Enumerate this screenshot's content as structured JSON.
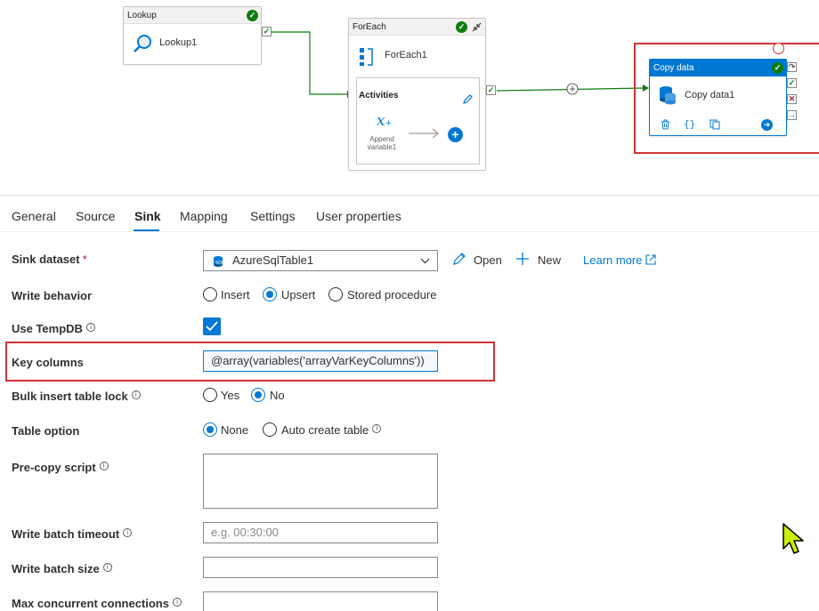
{
  "canvas": {
    "lookup": {
      "header": "Lookup",
      "name": "Lookup1",
      "icon": "search-icon"
    },
    "foreach": {
      "header": "ForEach",
      "name": "ForEach1",
      "activities_label": "Activities",
      "inner_activity": [
        "Append",
        "variable1"
      ],
      "inner_icon": "append-variable-icon"
    },
    "copy": {
      "header": "Copy data",
      "name": "Copy data1",
      "icon": "database-icon",
      "actions": [
        "delete-icon",
        "code-icon",
        "copy-icon",
        "arrow-right-icon"
      ]
    }
  },
  "tabs": [
    "General",
    "Source",
    "Sink",
    "Mapping",
    "Settings",
    "User properties"
  ],
  "active_tab": "Sink",
  "form": {
    "sink_dataset": {
      "label": "Sink dataset",
      "required_mark": "*",
      "value": "AzureSqlTable1",
      "open_label": "Open",
      "new_label": "New",
      "learn_more": "Learn more"
    },
    "write_behavior": {
      "label": "Write behavior",
      "options": [
        "Insert",
        "Upsert",
        "Stored procedure"
      ],
      "selected": "Upsert"
    },
    "use_tempdb": {
      "label": "Use TempDB",
      "checked": true
    },
    "key_columns": {
      "label": "Key columns",
      "value": "@array(variables('arrayVarKeyColumns'))"
    },
    "bulk_insert": {
      "label": "Bulk insert table lock",
      "options": [
        "Yes",
        "No"
      ],
      "selected": "No"
    },
    "table_option": {
      "label": "Table option",
      "options": [
        "None",
        "Auto create table"
      ],
      "selected": "None"
    },
    "pre_copy": {
      "label": "Pre-copy script",
      "value": ""
    },
    "write_batch_timeout": {
      "label": "Write batch timeout",
      "placeholder": "e.g. 00:30:00"
    },
    "write_batch_size": {
      "label": "Write batch size",
      "value": ""
    },
    "max_connections": {
      "label": "Max concurrent connections",
      "value": ""
    }
  },
  "colors": {
    "accent": "#0078d4",
    "success": "#107c10",
    "highlight": "#d13438",
    "error": "#a4262c"
  }
}
